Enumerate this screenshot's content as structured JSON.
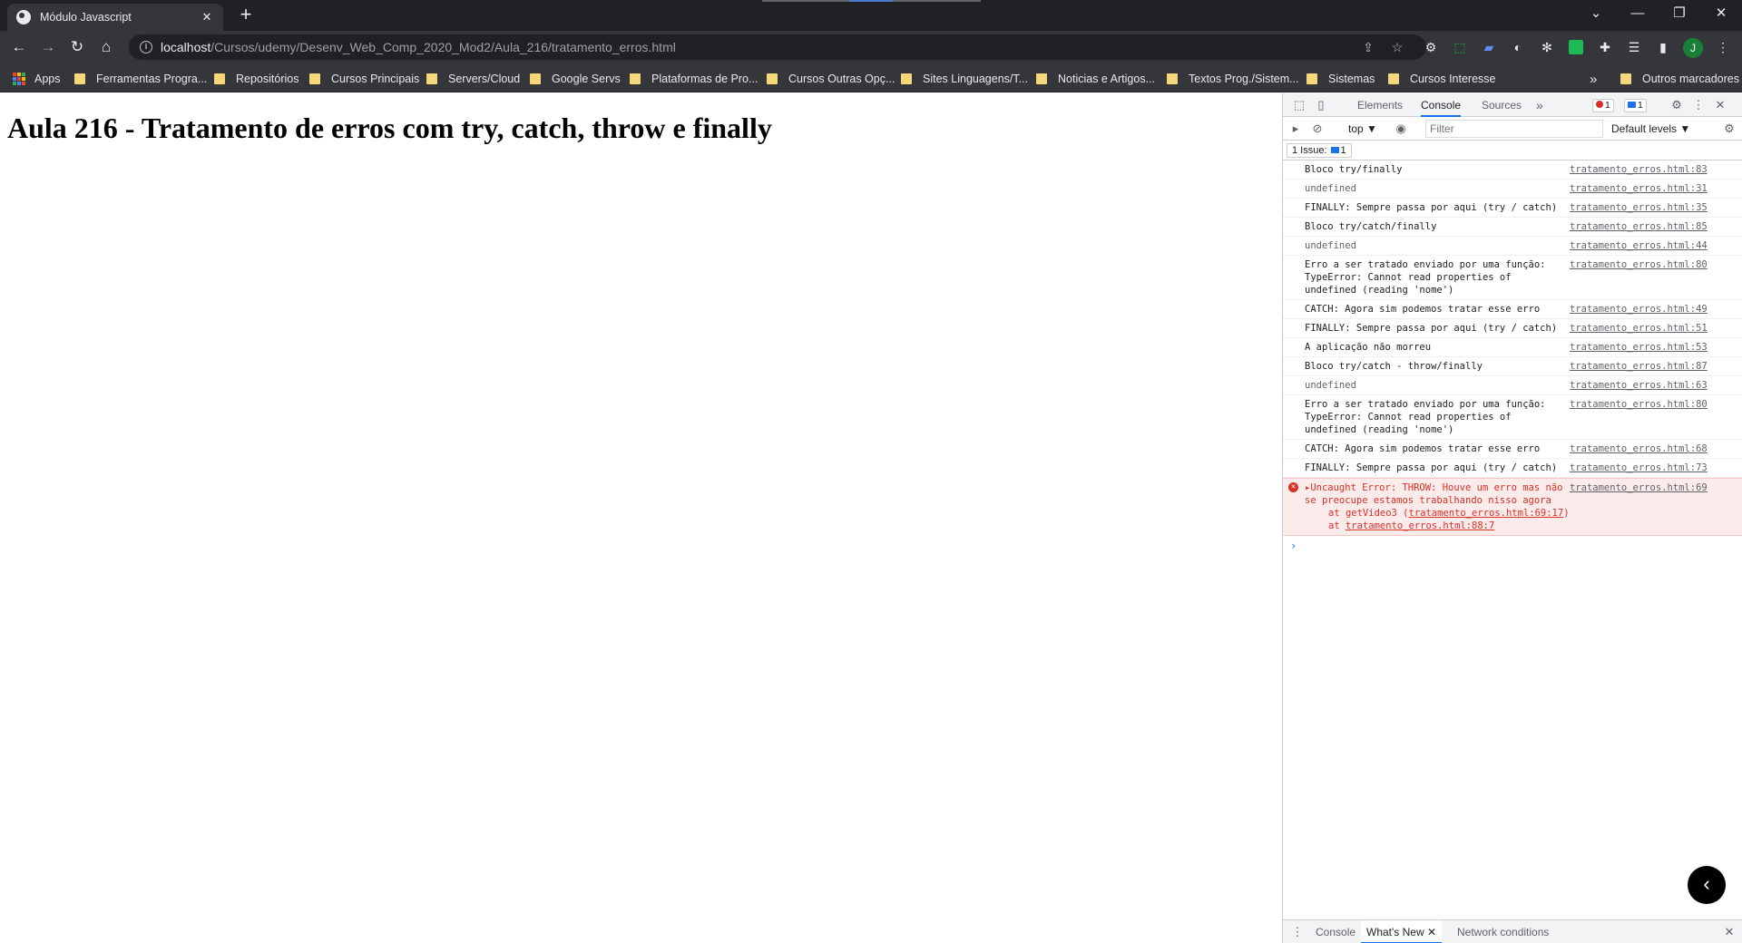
{
  "browser": {
    "tab_title": "Módulo Javascript",
    "tab_close": "✕",
    "new_tab": "+",
    "url_host": "localhost",
    "url_path": "/Cursos/udemy/Desenv_Web_Comp_2020_Mod2/Aula_216/tratamento_erros.html",
    "profile_initial": "J"
  },
  "bookmarks": [
    "Apps",
    "Ferramentas Progra...",
    "Repositórios",
    "Cursos Principais",
    "Servers/Cloud",
    "Google Servs",
    "Plataformas de Pro...",
    "Cursos Outras Opç...",
    "Sites Linguagens/T...",
    "Noticias e Artigos...",
    "Textos Prog./Sistem...",
    "Sistemas",
    "Cursos Interesse",
    "»",
    "Outros marcadores"
  ],
  "page": {
    "heading": "Aula 216 - Tratamento de erros com try, catch, throw e finally"
  },
  "devtools": {
    "tabs": [
      "Elements",
      "Console",
      "Sources",
      "»"
    ],
    "error_count": "1",
    "message_count": "1",
    "context": "top ▼",
    "filter_placeholder": "Filter",
    "levels": "Default levels ▼",
    "issues_label": "1 Issue:",
    "issues_count": "1",
    "messages": [
      {
        "text": "Bloco try/finally",
        "src": "tratamento_erros.html:83",
        "grey": false
      },
      {
        "text": "undefined",
        "src": "tratamento_erros.html:31",
        "grey": true
      },
      {
        "text": "FINALLY: Sempre passa por aqui (try / catch)",
        "src": "tratamento_erros.html:35",
        "grey": false
      },
      {
        "text": "Bloco try/catch/finally",
        "src": "tratamento_erros.html:85",
        "grey": false
      },
      {
        "text": "undefined",
        "src": "tratamento_erros.html:44",
        "grey": true
      },
      {
        "text": "Erro a ser tratado enviado por uma função: TypeError: Cannot read properties of undefined (reading 'nome')",
        "src": "tratamento_erros.html:80",
        "grey": false
      },
      {
        "text": "CATCH: Agora sim podemos tratar esse erro",
        "src": "tratamento_erros.html:49",
        "grey": false
      },
      {
        "text": "FINALLY: Sempre passa por aqui (try / catch)",
        "src": "tratamento_erros.html:51",
        "grey": false
      },
      {
        "text": "A aplicação não morreu",
        "src": "tratamento_erros.html:53",
        "grey": false
      },
      {
        "text": "Bloco try/catch - throw/finally",
        "src": "tratamento_erros.html:87",
        "grey": false
      },
      {
        "text": "undefined",
        "src": "tratamento_erros.html:63",
        "grey": true
      },
      {
        "text": "Erro a ser tratado enviado por uma função: TypeError: Cannot read properties of undefined (reading 'nome')",
        "src": "tratamento_erros.html:80",
        "grey": false
      },
      {
        "text": "CATCH: Agora sim podemos tratar esse erro",
        "src": "tratamento_erros.html:68",
        "grey": false
      },
      {
        "text": "FINALLY: Sempre passa por aqui (try / catch)",
        "src": "tratamento_erros.html:73",
        "grey": false
      }
    ],
    "error": {
      "text": "▸Uncaught Error: THROW: Houve um erro mas não se preocupe estamos trabalhando nisso agora",
      "src": "tratamento_erros.html:69",
      "stack1_prefix": "at getVideo3 (",
      "stack1_link": "tratamento_erros.html:69:17",
      "stack1_suffix": ")",
      "stack2_prefix": "at ",
      "stack2_link": "tratamento_erros.html:88:7"
    },
    "drawer_tabs": [
      "Console",
      "What's New",
      "Network conditions"
    ],
    "drawer_close": "✕"
  },
  "colors": {
    "accent": "#1a73e8",
    "error": "#d93025",
    "folder": "#f6d77a"
  }
}
